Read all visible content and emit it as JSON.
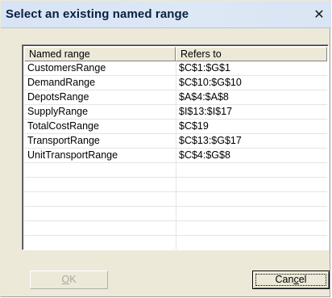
{
  "window": {
    "title": "Select an existing named range",
    "close_glyph": "✕"
  },
  "list": {
    "columns": [
      "Named range",
      "Refers to"
    ],
    "rows": [
      {
        "name": "CustomersRange",
        "ref": "$C$1:$G$1"
      },
      {
        "name": "DemandRange",
        "ref": "$C$10:$G$10"
      },
      {
        "name": "DepotsRange",
        "ref": "$A$4:$A$8"
      },
      {
        "name": "SupplyRange",
        "ref": "$I$13:$I$17"
      },
      {
        "name": "TotalCostRange",
        "ref": "$C$19"
      },
      {
        "name": "TransportRange",
        "ref": "$C$13:$G$17"
      },
      {
        "name": "UnitTransportRange",
        "ref": "$C$4:$G$8"
      },
      {
        "name": "",
        "ref": ""
      },
      {
        "name": "",
        "ref": ""
      },
      {
        "name": "",
        "ref": ""
      },
      {
        "name": "",
        "ref": ""
      },
      {
        "name": "",
        "ref": ""
      },
      {
        "name": "",
        "ref": ""
      }
    ]
  },
  "buttons": {
    "ok": {
      "pre": "",
      "accel": "O",
      "post": "K",
      "enabled": false
    },
    "cancel": {
      "pre": "Can",
      "accel": "c",
      "post": "el",
      "enabled": true
    }
  }
}
